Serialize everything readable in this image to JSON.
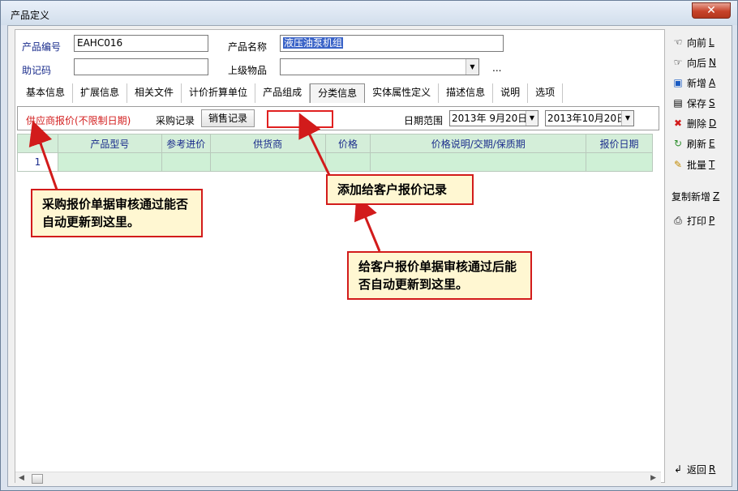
{
  "window": {
    "title": "产品定义",
    "close_glyph": "✕"
  },
  "form": {
    "code_label": "产品编号",
    "code_value": "EAHC016",
    "name_label": "产品名称",
    "name_value": "液压油泵机组",
    "mnemonic_label": "助记码",
    "mnemonic_value": "",
    "parent_label": "上级物品",
    "parent_value": "",
    "ellipsis": "..."
  },
  "tabs": [
    "基本信息",
    "扩展信息",
    "相关文件",
    "计价折算单位",
    "产品组成",
    "分类信息",
    "实体属性定义",
    "描述信息",
    "说明",
    "选项"
  ],
  "filter": {
    "supplier_quote": "供应商报价(不限制日期)",
    "purchase_records": "采购记录",
    "sales_records": "销售记录",
    "date_range_label": "日期范围",
    "date_from": "2013年  9月20日",
    "date_to": "2013年10月20日"
  },
  "grid": {
    "columns": [
      "一",
      "产品型号",
      "参考进价",
      "供货商",
      "价格",
      "价格说明/交期/保质期",
      "报价日期"
    ],
    "rows": [
      [
        "1",
        "",
        "",
        "",
        "",
        "",
        ""
      ]
    ]
  },
  "sidebar": [
    {
      "icon": "prev-icon",
      "glyph": "☜",
      "label": "向前",
      "key": "L"
    },
    {
      "icon": "next-icon",
      "glyph": "☞",
      "label": "向后",
      "key": "N"
    },
    {
      "icon": "add-icon",
      "glyph": "▣",
      "label": "新增",
      "key": "A"
    },
    {
      "icon": "save-icon",
      "glyph": "▤",
      "label": "保存",
      "key": "S"
    },
    {
      "icon": "delete-icon",
      "glyph": "✖",
      "label": "删除",
      "key": "D"
    },
    {
      "icon": "refresh-icon",
      "glyph": "↻",
      "label": "刷新",
      "key": "E"
    },
    {
      "icon": "batch-icon",
      "glyph": "✎",
      "label": "批量",
      "key": "T"
    },
    {
      "icon": "",
      "glyph": "",
      "label": "复制新增",
      "key": "Z"
    },
    {
      "icon": "print-icon",
      "glyph": "⎙",
      "label": "打印",
      "key": "P"
    },
    {
      "icon": "return-icon",
      "glyph": "↲",
      "label": "返回",
      "key": "R"
    }
  ],
  "callouts": {
    "purchase": "采购报价单据审核通过能否自动更新到这里。",
    "add_customer": "添加给客户报价记录",
    "customer": "给客户报价单据审核通过后能否自动更新到这里。"
  },
  "colors": {
    "annotation_red": "#d21b1b",
    "callout_bg": "#fff7d2",
    "grid_row": "#cff0d6"
  }
}
